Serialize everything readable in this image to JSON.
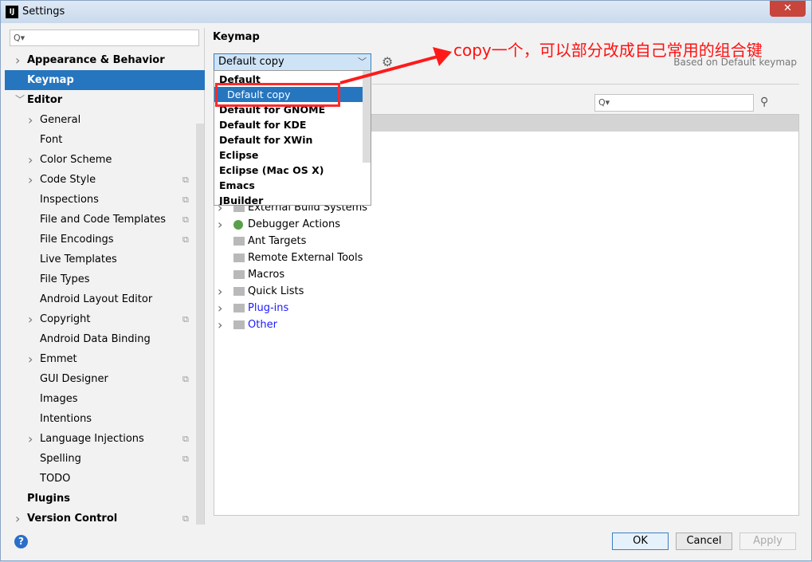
{
  "window": {
    "title": "Settings",
    "logo": "IJ",
    "close": "✕"
  },
  "sidebar": {
    "search_placeholder": "Q▾",
    "items": [
      {
        "label": "Appearance & Behavior",
        "level": 0,
        "bold": true,
        "chevron": "right",
        "copy": false
      },
      {
        "label": "Keymap",
        "level": 0,
        "bold": true,
        "chevron": "",
        "copy": false,
        "selected": true
      },
      {
        "label": "Editor",
        "level": 0,
        "bold": true,
        "chevron": "down",
        "copy": false
      },
      {
        "label": "General",
        "level": 1,
        "chevron": "right",
        "copy": false
      },
      {
        "label": "Font",
        "level": 1,
        "chevron": "",
        "copy": false
      },
      {
        "label": "Color Scheme",
        "level": 1,
        "chevron": "right",
        "copy": false
      },
      {
        "label": "Code Style",
        "level": 1,
        "chevron": "right",
        "copy": true
      },
      {
        "label": "Inspections",
        "level": 1,
        "chevron": "",
        "copy": true
      },
      {
        "label": "File and Code Templates",
        "level": 1,
        "chevron": "",
        "copy": true
      },
      {
        "label": "File Encodings",
        "level": 1,
        "chevron": "",
        "copy": true
      },
      {
        "label": "Live Templates",
        "level": 1,
        "chevron": "",
        "copy": false
      },
      {
        "label": "File Types",
        "level": 1,
        "chevron": "",
        "copy": false
      },
      {
        "label": "Android Layout Editor",
        "level": 1,
        "chevron": "",
        "copy": false
      },
      {
        "label": "Copyright",
        "level": 1,
        "chevron": "right",
        "copy": true
      },
      {
        "label": "Android Data Binding",
        "level": 1,
        "chevron": "",
        "copy": false
      },
      {
        "label": "Emmet",
        "level": 1,
        "chevron": "right",
        "copy": false
      },
      {
        "label": "GUI Designer",
        "level": 1,
        "chevron": "",
        "copy": true
      },
      {
        "label": "Images",
        "level": 1,
        "chevron": "",
        "copy": false
      },
      {
        "label": "Intentions",
        "level": 1,
        "chevron": "",
        "copy": false
      },
      {
        "label": "Language Injections",
        "level": 1,
        "chevron": "right",
        "copy": true
      },
      {
        "label": "Spelling",
        "level": 1,
        "chevron": "",
        "copy": true
      },
      {
        "label": "TODO",
        "level": 1,
        "chevron": "",
        "copy": false
      },
      {
        "label": "Plugins",
        "level": 0,
        "bold": true,
        "chevron": "",
        "copy": false
      },
      {
        "label": "Version Control",
        "level": 0,
        "bold": true,
        "chevron": "right",
        "copy": true
      }
    ]
  },
  "keymap": {
    "heading": "Keymap",
    "selected": "Default copy",
    "based_on": "Based on Default keymap",
    "filter_placeholder": "Q▾",
    "options": [
      "Default",
      "Default copy",
      "Default for GNOME",
      "Default for KDE",
      "Default for XWin",
      "Eclipse",
      "Eclipse (Mac OS X)",
      "Emacs",
      "JBuilder"
    ],
    "tree": [
      {
        "label": "External Build Systems",
        "chevron": true,
        "icon": "folder-icon",
        "link": false
      },
      {
        "label": "Debugger Actions",
        "chevron": true,
        "icon": "bug-icon",
        "link": false
      },
      {
        "label": "Ant Targets",
        "chevron": false,
        "icon": "folder-icon",
        "link": false
      },
      {
        "label": "Remote External Tools",
        "chevron": false,
        "icon": "folder-icon",
        "link": false
      },
      {
        "label": "Macros",
        "chevron": false,
        "icon": "folder-icon",
        "link": false
      },
      {
        "label": "Quick Lists",
        "chevron": true,
        "icon": "folder-icon",
        "link": false
      },
      {
        "label": "Plug-ins",
        "chevron": true,
        "icon": "folder-icon",
        "link": true
      },
      {
        "label": "Other",
        "chevron": true,
        "icon": "folder-icon",
        "link": true
      }
    ]
  },
  "annotation": {
    "text": "copy一个，可以部分改成自己常用的组合键",
    "color": "#ff1010"
  },
  "footer": {
    "help": "?",
    "ok": "OK",
    "cancel": "Cancel",
    "apply": "Apply"
  }
}
